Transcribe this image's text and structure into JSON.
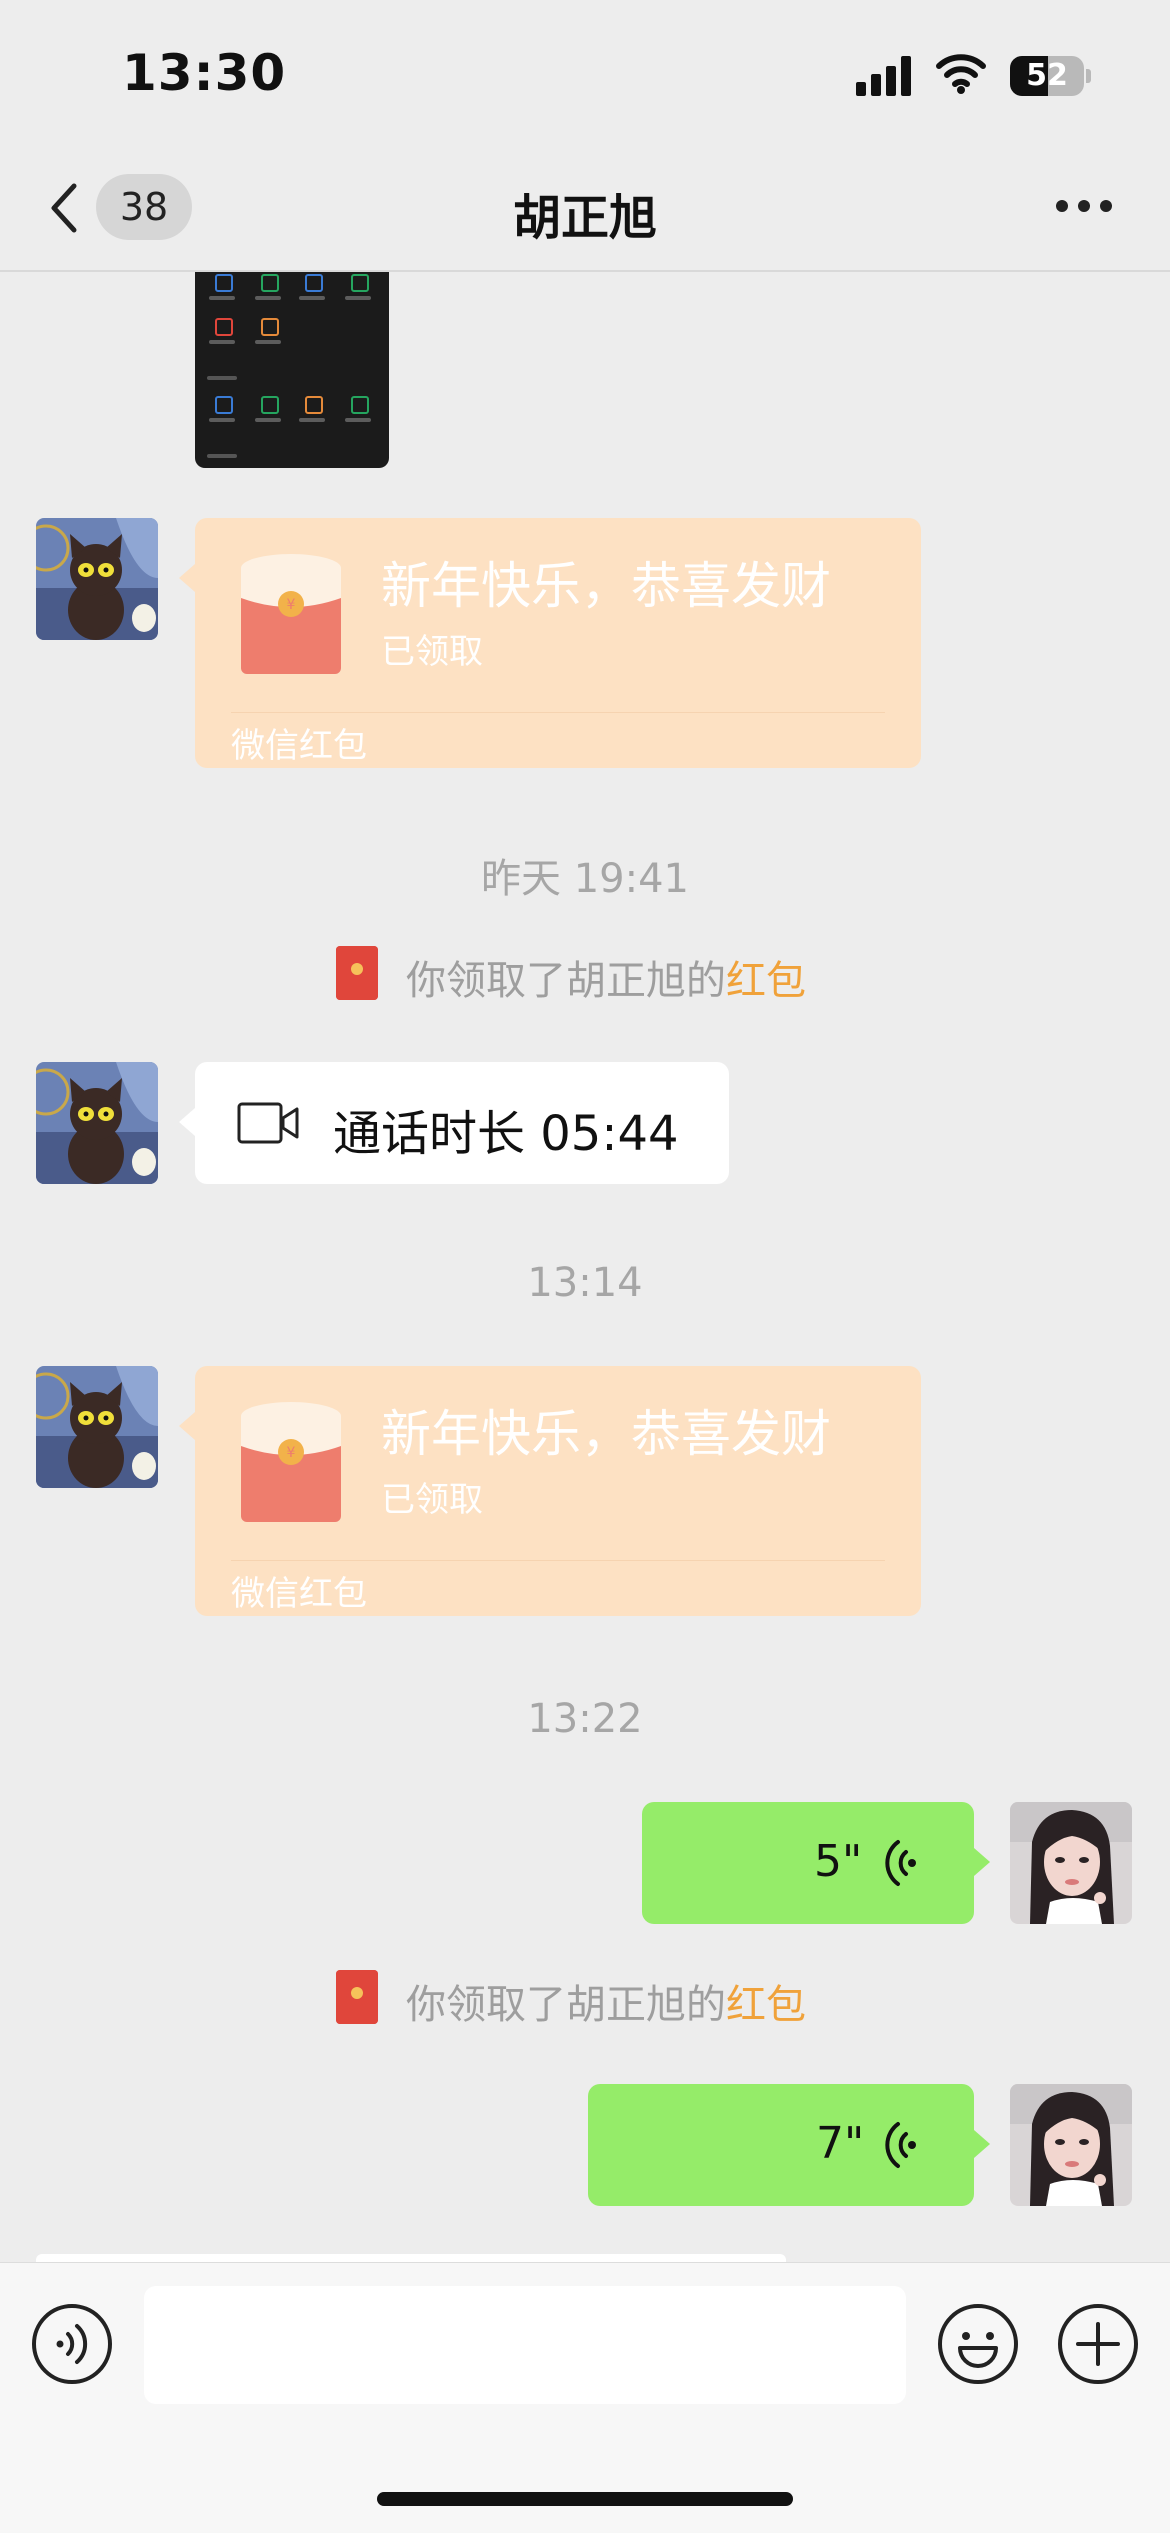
{
  "status_bar": {
    "time": "13:30",
    "battery": "52",
    "battery_level": 0.52
  },
  "nav": {
    "unread_count": "38",
    "title": "胡正旭"
  },
  "messages": {
    "red_packet_1": {
      "greeting": "新年快乐，恭喜发财",
      "status": "已领取",
      "footer": "微信红包"
    },
    "timestamp_1": "昨天 19:41",
    "system_1": {
      "prefix": "你领取了胡正旭的",
      "link": "红包"
    },
    "call": {
      "text": "通话时长 05:44"
    },
    "timestamp_2": "13:14",
    "red_packet_2": {
      "greeting": "新年快乐，恭喜发财",
      "status": "已领取",
      "footer": "微信红包"
    },
    "timestamp_3": "13:22",
    "voice_1": {
      "duration": "5\""
    },
    "system_2": {
      "prefix": "你领取了胡正旭的",
      "link": "红包"
    },
    "voice_2": {
      "duration": "7\""
    }
  },
  "input_bar": {
    "value": ""
  },
  "icons": {
    "back": "chevron-left-icon",
    "more": "more-icon",
    "video_call": "video-camera-icon",
    "voice_wave": "voice-wave-icon",
    "voice_toggle": "voice-mode-icon",
    "emoji": "emoji-icon",
    "plus": "plus-icon"
  },
  "colors": {
    "background": "#ededed",
    "red_packet": "#fde1c3",
    "outgoing_bubble": "#95ec69",
    "link_orange": "#f0a23a"
  }
}
